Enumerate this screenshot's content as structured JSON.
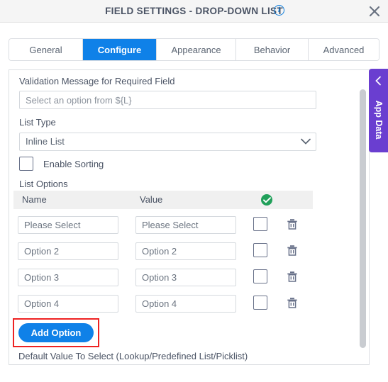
{
  "titlebar": {
    "title": "FIELD SETTINGS - DROP-DOWN LIST",
    "info_icon": "info-circle-icon",
    "info_glyph": "i",
    "close_icon": "close-icon"
  },
  "tabs": [
    {
      "label": "General",
      "active": false
    },
    {
      "label": "Configure",
      "active": true
    },
    {
      "label": "Appearance",
      "active": false
    },
    {
      "label": "Behavior",
      "active": false
    },
    {
      "label": "Advanced",
      "active": false
    }
  ],
  "form": {
    "validation_label": "Validation Message for Required Field",
    "validation_placeholder": "Select an option from ${L}",
    "validation_value": "",
    "list_type_label": "List Type",
    "list_type_value": "Inline List",
    "list_type_options": [
      "Inline List"
    ],
    "enable_sorting_label": "Enable Sorting",
    "enable_sorting_checked": false,
    "list_options_label": "List Options"
  },
  "options_table": {
    "columns": [
      "Name",
      "Value"
    ],
    "selected_header_icon": "green-check-circle-icon",
    "rows": [
      {
        "name": "Please Select",
        "value": "Please Select",
        "selected": false,
        "delete_icon": "trash-icon"
      },
      {
        "name": "Option 2",
        "value": "Option 2",
        "selected": false,
        "delete_icon": "trash-icon"
      },
      {
        "name": "Option 3",
        "value": "Option 3",
        "selected": false,
        "delete_icon": "trash-icon"
      },
      {
        "name": "Option 4",
        "value": "Option 4",
        "selected": false,
        "delete_icon": "trash-icon"
      }
    ]
  },
  "actions": {
    "add_option_label": "Add Option",
    "add_option_highlight_color": "#ee2222",
    "add_option_color": "#0f81e8"
  },
  "footer": {
    "default_value_label": "Default Value To Select (Lookup/Predefined List/Picklist)"
  },
  "side_panel": {
    "label": "App Data",
    "color": "#6a3ed0",
    "collapse_icon": "chevron-left-icon"
  }
}
